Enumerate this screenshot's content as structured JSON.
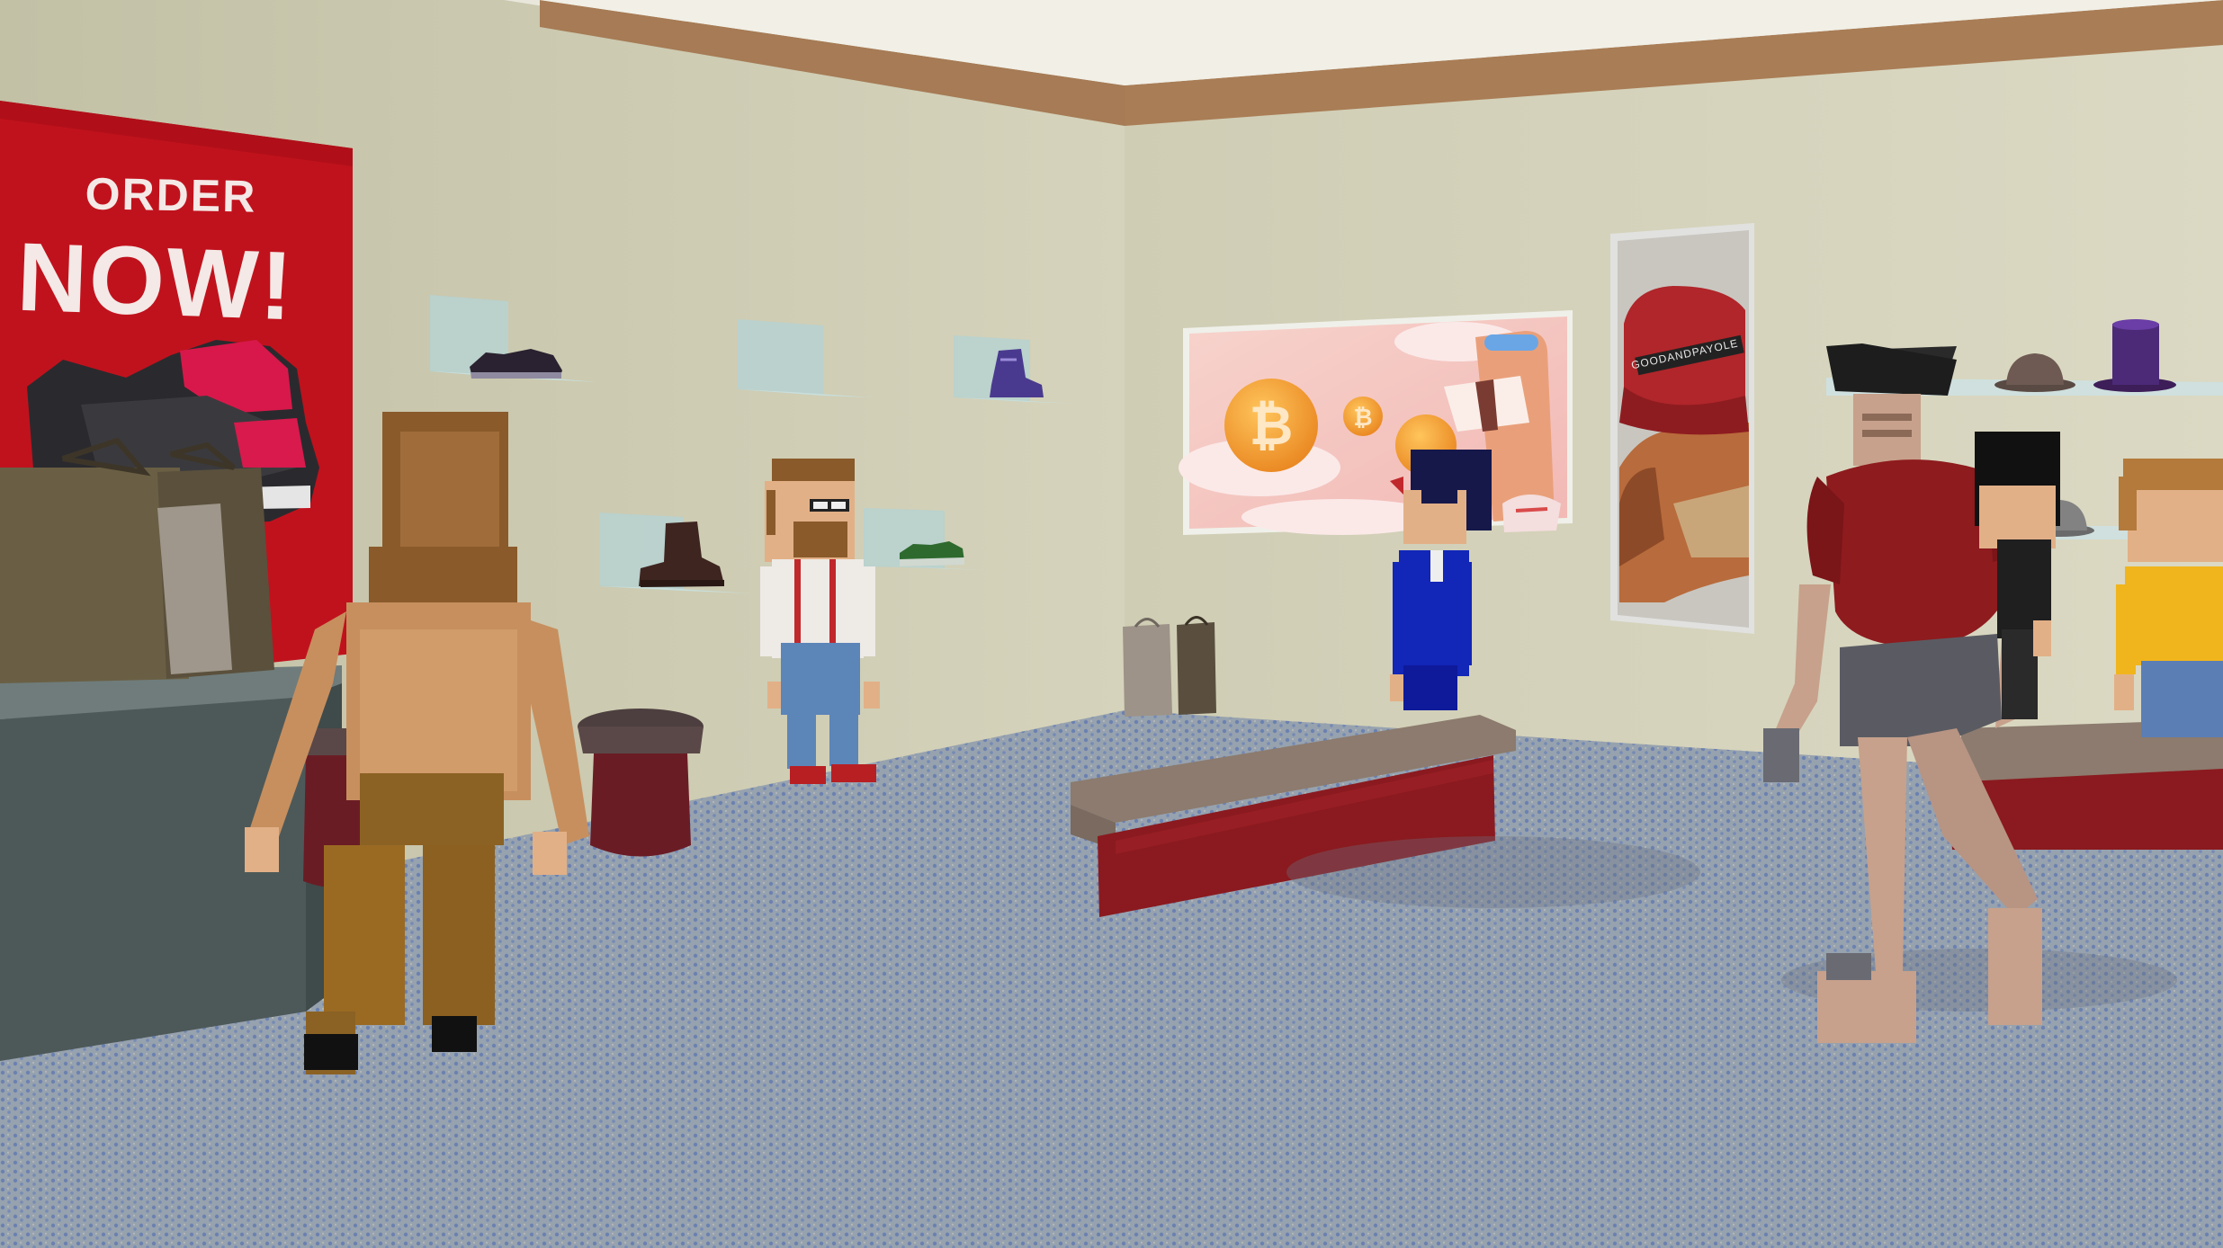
{
  "scene": {
    "type": "3d-shoe-store",
    "colors": {
      "wall_left": "#cac8ad",
      "wall_back": "#d6d4bd",
      "ceiling": "#e8e6da",
      "trim": "#a87c55",
      "carpet": "#8b98a5",
      "poster_red": "#c0141e",
      "bench_top": "#8c7b6e",
      "bench_side": "#8a1a1f",
      "counter": "#4e5a5b",
      "bitcoin_bg": "#f6c6be",
      "bitcoin_coin": "#f39a36"
    }
  },
  "posters": {
    "order_poster": {
      "line1": "ORDER",
      "line2": "NOW!"
    },
    "cap_poster": {
      "brand": "GOODANDPAYOLE"
    },
    "bitcoin_poster": {
      "coin_symbol": "₿"
    }
  },
  "products": {
    "shoes": [
      "sneaker-dark",
      "boot-purple",
      "boot-brown",
      "sneaker-green",
      "empty-shelf"
    ],
    "hats": [
      "fedora-brown",
      "top-hat-purple",
      "cap-grey",
      "fedora-grey"
    ]
  },
  "avatars": [
    "avatar-brown-back",
    "avatar-glasses-white-shirt",
    "avatar-blue-suit",
    "avatar-red-armor",
    "avatar-black-hair",
    "avatar-yellow-shirt"
  ]
}
